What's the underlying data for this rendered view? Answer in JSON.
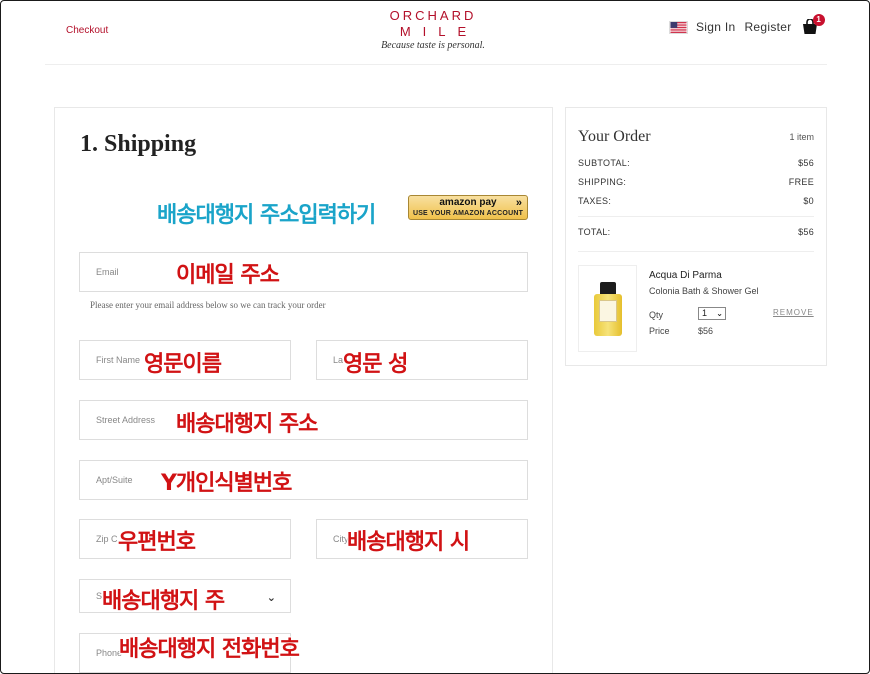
{
  "header": {
    "checkout_label": "Checkout",
    "logo_line1": "ORCHARD",
    "logo_line2": "MILE",
    "logo_tagline": "Because taste is personal.",
    "sign_in": "Sign In",
    "register": "Register",
    "cart_count": "1",
    "flag_icon": "us-flag-icon",
    "cart_icon": "shopping-bag-icon",
    "accent_color": "#b3102a"
  },
  "shipping": {
    "title": "1. Shipping",
    "amazon": {
      "top": "amazon pay",
      "bottom": "USE YOUR AMAZON ACCOUNT",
      "arrows": "»"
    },
    "email_placeholder": "Email",
    "email_helper": "Please enter your email address below so we can track your order",
    "first_name_placeholder": "First Name",
    "last_name_placeholder": "La",
    "street_placeholder": "Street Address",
    "apt_placeholder": "Apt/Suite",
    "zip_placeholder": "Zip C",
    "city_placeholder": "City",
    "state_placeholder": "S",
    "phone_placeholder": "Phone"
  },
  "annotations": {
    "amazon_note": "배송대행지 주소입력하기",
    "email_note": "이메일 주소",
    "first_name_note": "영문이름",
    "last_name_note": "영문 성",
    "street_note": "배송대행지 주소",
    "apt_note": "Y개인식별번호",
    "zip_note": "우편번호",
    "city_note": "배송대행지 시",
    "state_note": "배송대행지 주",
    "phone_note": "배송대행지 전화번호"
  },
  "order": {
    "title": "Your Order",
    "item_count": "1 item",
    "subtotal_label": "SUBTOTAL:",
    "subtotal_value": "$56",
    "shipping_label": "SHIPPING:",
    "shipping_value": "FREE",
    "taxes_label": "TAXES:",
    "taxes_value": "$0",
    "total_label": "TOTAL:",
    "total_value": "$56",
    "product": {
      "brand": "Acqua Di Parma",
      "name": "Colonia Bath & Shower Gel",
      "qty_label": "Qty",
      "qty_value": "1",
      "price_label": "Price",
      "price_value": "$56",
      "remove_label": "REMOVE"
    }
  }
}
